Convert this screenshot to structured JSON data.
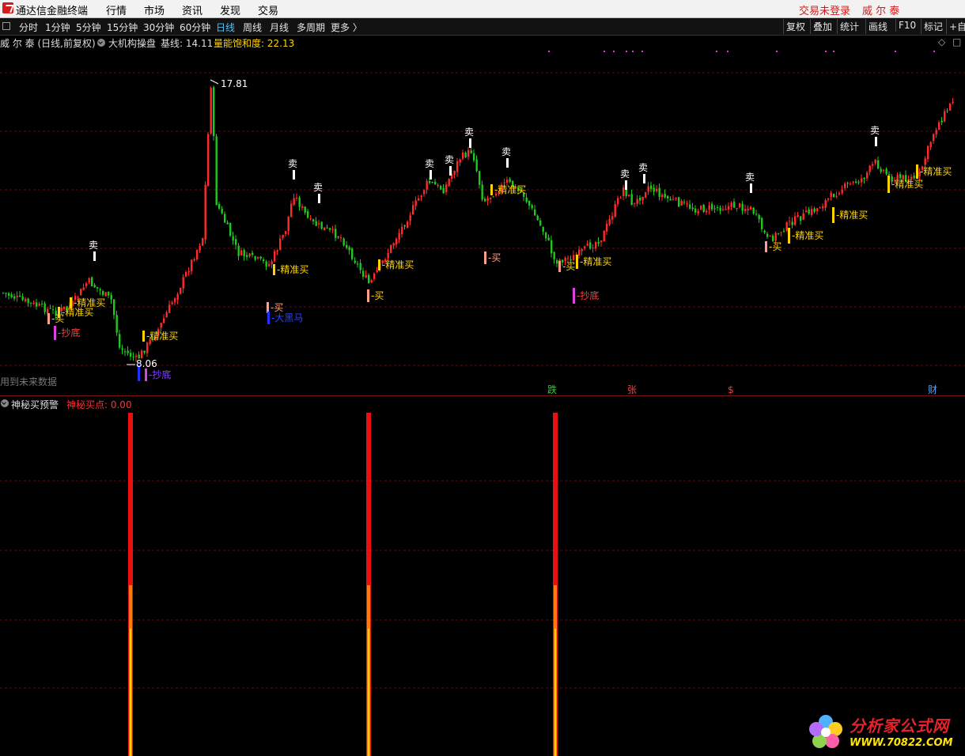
{
  "menubar": {
    "app_title": "通达信金融终端",
    "items": [
      "行情",
      "市场",
      "资讯",
      "发现",
      "交易"
    ],
    "trade_status": "交易未登录",
    "stock_name": "威 尔 泰"
  },
  "toolbar": {
    "periods": [
      "分时",
      "1分钟",
      "5分钟",
      "15分钟",
      "30分钟",
      "60分钟",
      "日线",
      "周线",
      "月线",
      "多周期",
      "更多 〉"
    ],
    "active_period": "日线",
    "right_buttons": [
      "复权",
      "叠加",
      "统计",
      "画线",
      "F10",
      "标记",
      "+自"
    ]
  },
  "infobar": {
    "stock_desc": "威 尔 泰 (日线,前复权)",
    "indicator_name": "大机构操盘",
    "base_label": "基线: 14.11",
    "saturation_label": "量能饱和度: 22.13"
  },
  "chart": {
    "price_high_label": "17.81",
    "price_low_label": "8.06",
    "future_note": "用到未来数据",
    "signal_labels": {
      "sell": "卖",
      "buy": "买",
      "precise_buy": "精准买",
      "bottom": "抄底",
      "dark_horse": "大黑马"
    },
    "event_markers": [
      "跌",
      "张",
      "$",
      "财"
    ]
  },
  "indicator": {
    "name": "神秘买预警",
    "value_label": "神秘买点: 0.00"
  },
  "watermark": {
    "title": "分析家公式网",
    "url": "WWW.70822.COM"
  },
  "colors": {
    "up": "#ff2a2a",
    "down": "#1ec81e",
    "text_signal": "#ffd400",
    "grid": "#5a0c0c"
  }
}
